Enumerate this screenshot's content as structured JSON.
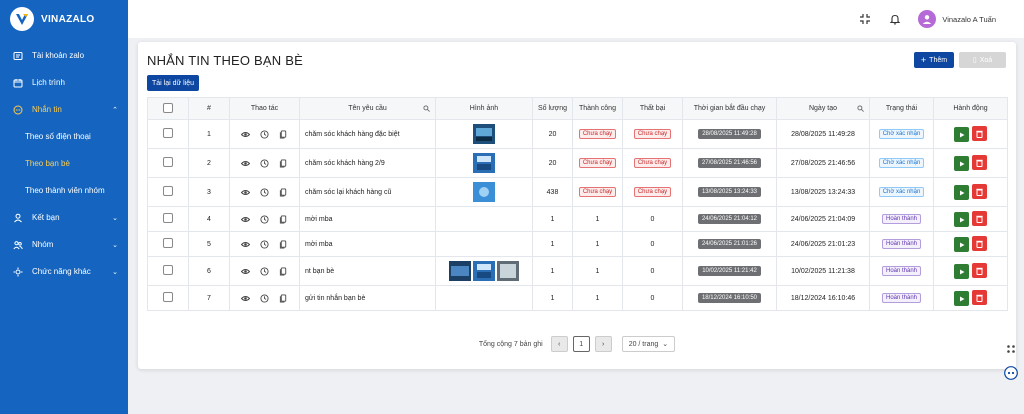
{
  "brand": {
    "name": "VINAZALO"
  },
  "sidebar": {
    "items": [
      {
        "label": "Tài khoản zalo",
        "icon": "id-card-icon"
      },
      {
        "label": "Lịch trình",
        "icon": "calendar-icon"
      },
      {
        "label": "Nhắn tin",
        "icon": "chat-icon"
      },
      {
        "label": "Kết bạn",
        "icon": "user-icon"
      },
      {
        "label": "Nhóm",
        "icon": "group-icon"
      },
      {
        "label": "Chức năng khác",
        "icon": "sun-icon"
      }
    ],
    "sub_items": [
      {
        "label": "Theo số điện thoại"
      },
      {
        "label": "Theo bạn bè"
      },
      {
        "label": "Theo thành viên nhóm"
      }
    ]
  },
  "topbar": {
    "user_name": "Vinazalo A Tuấn"
  },
  "main": {
    "title": "NHẮN TIN THEO BẠN BÈ",
    "reload_label": "Tải lại dữ liệu",
    "add_label": "Thêm",
    "delete_label": "Xoá"
  },
  "table": {
    "headers": [
      "#",
      "Thao tác",
      "Tên yêu cầu",
      "Hình ảnh",
      "Số lượng",
      "Thành công",
      "Thất bại",
      "Thời gian bắt đầu chạy",
      "Ngày tạo",
      "Trạng thái",
      "Hành động"
    ],
    "rows": [
      {
        "no": "1",
        "name": "chăm sóc khách hàng đặc biệt",
        "qty": "20",
        "success": "Chưa chạy",
        "fail": "Chưa chạy",
        "start": "28/08/2025 11:49:28",
        "created": "28/08/2025 11:49:28",
        "status": "Chờ xác nhận"
      },
      {
        "no": "2",
        "name": "chăm sóc khách hàng 2/9",
        "qty": "20",
        "success": "Chưa chạy",
        "fail": "Chưa chạy",
        "start": "27/08/2025 21:46:56",
        "created": "27/08/2025 21:46:56",
        "status": "Chờ xác nhận"
      },
      {
        "no": "3",
        "name": "chăm sóc lại khách hàng cũ",
        "qty": "438",
        "success": "Chưa chạy",
        "fail": "Chưa chạy",
        "start": "13/08/2025 13:24:33",
        "created": "13/08/2025 13:24:33",
        "status": "Chờ xác nhận"
      },
      {
        "no": "4",
        "name": "mời mba",
        "qty": "1",
        "success": "1",
        "fail": "0",
        "start": "24/06/2025 21:04:12",
        "created": "24/06/2025 21:04:09",
        "status": "Hoàn thành"
      },
      {
        "no": "5",
        "name": "mời mba",
        "qty": "1",
        "success": "1",
        "fail": "0",
        "start": "24/06/2025 21:01:26",
        "created": "24/06/2025 21:01:23",
        "status": "Hoàn thành"
      },
      {
        "no": "6",
        "name": "nt bạn bè",
        "qty": "1",
        "success": "1",
        "fail": "0",
        "start": "10/02/2025 11:21:42",
        "created": "10/02/2025 11:21:38",
        "status": "Hoàn thành"
      },
      {
        "no": "7",
        "name": "gửi tin nhắn bạn bè",
        "qty": "1",
        "success": "1",
        "fail": "0",
        "start": "18/12/2024 16:10:50",
        "created": "18/12/2024 16:10:46",
        "status": "Hoàn thành"
      }
    ]
  },
  "pagination": {
    "total_label": "Tổng cộng 7 bản ghi",
    "current_page": "1",
    "page_size_label": "20 / trang"
  },
  "colors": {
    "sidebar": "#1565c0",
    "primary": "#0d47a1",
    "active_sub": "#ffcc4d",
    "play": "#2e7d32",
    "trash": "#e53935"
  }
}
